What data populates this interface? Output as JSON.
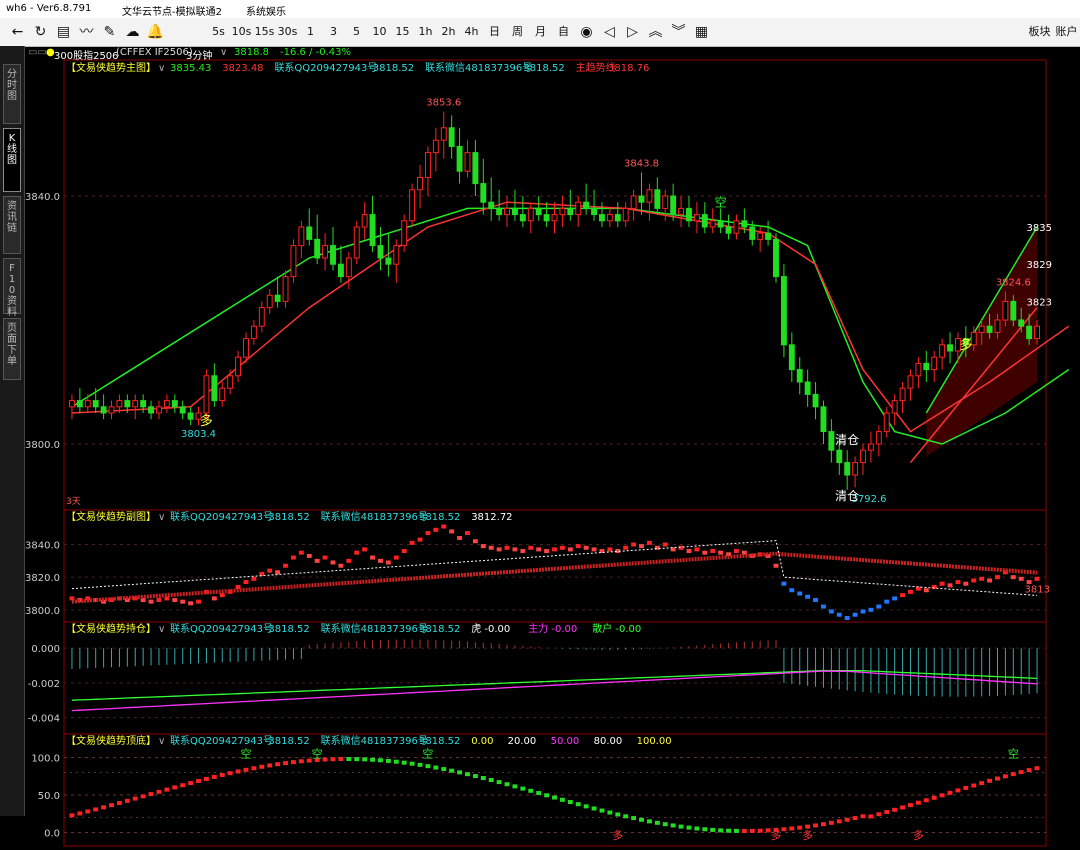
{
  "titlebar": {
    "left": "wh6  -  Ver6.8.791",
    "center": "文华云节点-模拟联通2",
    "right": "系统娱乐"
  },
  "toolbar": {
    "nav_icons": [
      "back-arrow-icon",
      "refresh-icon",
      "report-icon",
      "chart-trend-icon",
      "draw-tool-icon",
      "cloud-sync-icon",
      "bell-icon"
    ],
    "periods": [
      "5s",
      "10s",
      "15s",
      "30s",
      "1",
      "3",
      "5",
      "10",
      "15",
      "1h",
      "2h",
      "4h",
      "日",
      "周",
      "月",
      "自"
    ],
    "tool_icons": [
      "eye-icon",
      "arrow-left-icon",
      "arrow-right-icon",
      "chevron-up-icon",
      "chevron-down-icon",
      "grid-icon"
    ],
    "right_buttons": [
      "板块",
      "账户"
    ]
  },
  "left_tabs": [
    {
      "label": "分时图",
      "active": false
    },
    {
      "label": "K线图",
      "active": true
    },
    {
      "label": "资讯链",
      "active": false
    },
    {
      "label": "F10资料",
      "active": false
    },
    {
      "label": "页面下单",
      "active": false
    }
  ],
  "infobar": {
    "contract": "300股指2506",
    "exchange": "(CFFEX IF2506)",
    "period": "3分钟",
    "price": "3818.8",
    "change": "-16.6 / -0.43%"
  },
  "main_panel": {
    "title": "【文易侠趋势主图】",
    "values": [
      {
        "text": "3835.43",
        "color": "#22ee22"
      },
      {
        "text": "3823.48",
        "color": "#ff3333"
      },
      {
        "text": "联系QQ209427943号",
        "color": "#33dddd"
      },
      {
        "text": "3818.52",
        "color": "#33dddd"
      },
      {
        "text": "联系微信481837396号",
        "color": "#33dddd"
      },
      {
        "text": "3818.52",
        "color": "#33dddd"
      },
      {
        "text": "主趋势线",
        "color": "#ff3333"
      },
      {
        "text": "3818.76",
        "color": "#ff3333"
      }
    ],
    "y_ticks": [
      "3840.0",
      "3800.0"
    ],
    "annotations": {
      "high": "3853.6",
      "high2": "3843.8",
      "low_left": "3803.4",
      "low_mid": "3792.6",
      "high_right": "3824.6",
      "channel_upper": "3835",
      "channel_mid": "3829",
      "channel_lower": "3823",
      "buy_label": "多",
      "sell_label": "空",
      "clear_label": "清仓",
      "period_note": "3天"
    }
  },
  "sub1_panel": {
    "title": "【文易侠趋势副图】",
    "qq": "联系QQ209427943号",
    "qq_val": "3818.52",
    "wx": "联系微信481837396号",
    "wx_val": "3818.52",
    "extra": "3812.72",
    "y_ticks": [
      "3840.0",
      "3820.0",
      "3800.0"
    ],
    "last_label": "3813"
  },
  "sub2_panel": {
    "title": "【文易侠趋势持仓】",
    "qq": "联系QQ209427943号",
    "qq_val": "3818.52",
    "wx": "联系微信481837396号",
    "wx_val": "3818.52",
    "legend": [
      {
        "text": "虎 -0.00",
        "color": "#ffffff"
      },
      {
        "text": "主力 -0.00",
        "color": "#ff33ff"
      },
      {
        "text": "散户 -0.00",
        "color": "#33ff33"
      }
    ],
    "y_ticks": [
      "0.000",
      "-0.002",
      "-0.004"
    ]
  },
  "sub3_panel": {
    "title": "【文易侠趋势顶底】",
    "qq": "联系QQ209427943号",
    "qq_val": "3818.52",
    "wx": "联系微信481837396号",
    "wx_val": "3818.52",
    "levels": [
      {
        "text": "0.00",
        "color": "#ffff33"
      },
      {
        "text": "20.00",
        "color": "#ffffff"
      },
      {
        "text": "50.00",
        "color": "#ff33ff"
      },
      {
        "text": "80.00",
        "color": "#ffffff"
      },
      {
        "text": "100.00",
        "color": "#ffff33"
      }
    ],
    "y_ticks": [
      "100.0",
      "50.0",
      "0.0"
    ]
  },
  "chart_data": {
    "type": "candlestick",
    "note_series": "3-minute IF2506 bars, approximate reading",
    "candles": [
      [
        3806,
        3808,
        3804,
        3807
      ],
      [
        3807,
        3809,
        3805,
        3806
      ],
      [
        3806,
        3808,
        3805,
        3807
      ],
      [
        3807,
        3809,
        3805,
        3806
      ],
      [
        3806,
        3808,
        3804,
        3805
      ],
      [
        3805,
        3807,
        3804,
        3806
      ],
      [
        3806,
        3808,
        3805,
        3807
      ],
      [
        3807,
        3808,
        3805,
        3806
      ],
      [
        3806,
        3808,
        3804,
        3807
      ],
      [
        3807,
        3808,
        3805,
        3806
      ],
      [
        3806,
        3807,
        3804,
        3805
      ],
      [
        3805,
        3807,
        3804,
        3806
      ],
      [
        3806,
        3808,
        3805,
        3807
      ],
      [
        3807,
        3808,
        3805,
        3806
      ],
      [
        3806,
        3807,
        3804,
        3805
      ],
      [
        3805,
        3806,
        3803,
        3804
      ],
      [
        3804,
        3806,
        3803,
        3805
      ],
      [
        3805,
        3812,
        3804,
        3811
      ],
      [
        3811,
        3813,
        3806,
        3807
      ],
      [
        3807,
        3810,
        3806,
        3809
      ],
      [
        3809,
        3812,
        3808,
        3811
      ],
      [
        3811,
        3815,
        3810,
        3814
      ],
      [
        3814,
        3818,
        3813,
        3817
      ],
      [
        3817,
        3820,
        3816,
        3819
      ],
      [
        3819,
        3823,
        3818,
        3822
      ],
      [
        3822,
        3825,
        3821,
        3824
      ],
      [
        3824,
        3827,
        3822,
        3823
      ],
      [
        3823,
        3828,
        3822,
        3827
      ],
      [
        3827,
        3833,
        3826,
        3832
      ],
      [
        3832,
        3836,
        3830,
        3835
      ],
      [
        3835,
        3838,
        3832,
        3833
      ],
      [
        3833,
        3837,
        3829,
        3830
      ],
      [
        3830,
        3834,
        3828,
        3832
      ],
      [
        3832,
        3835,
        3828,
        3829
      ],
      [
        3829,
        3832,
        3826,
        3827
      ],
      [
        3827,
        3831,
        3825,
        3830
      ],
      [
        3830,
        3836,
        3829,
        3835
      ],
      [
        3835,
        3839,
        3833,
        3837
      ],
      [
        3837,
        3840,
        3831,
        3832
      ],
      [
        3832,
        3835,
        3828,
        3830
      ],
      [
        3830,
        3834,
        3827,
        3829
      ],
      [
        3829,
        3833,
        3826,
        3832
      ],
      [
        3832,
        3837,
        3831,
        3836
      ],
      [
        3836,
        3842,
        3835,
        3841
      ],
      [
        3841,
        3845,
        3838,
        3843
      ],
      [
        3843,
        3848,
        3840,
        3847
      ],
      [
        3847,
        3851,
        3844,
        3849
      ],
      [
        3849,
        3853.6,
        3846,
        3851
      ],
      [
        3851,
        3853,
        3846,
        3848
      ],
      [
        3848,
        3851,
        3842,
        3844
      ],
      [
        3844,
        3849,
        3843,
        3847
      ],
      [
        3847,
        3849,
        3840,
        3842
      ],
      [
        3842,
        3846,
        3837,
        3839
      ],
      [
        3839,
        3843,
        3836,
        3838
      ],
      [
        3838,
        3841,
        3836,
        3837
      ],
      [
        3837,
        3840,
        3835,
        3838
      ],
      [
        3838,
        3841,
        3836,
        3837
      ],
      [
        3837,
        3840,
        3835,
        3836
      ],
      [
        3836,
        3839,
        3834,
        3838
      ],
      [
        3838,
        3840,
        3836,
        3837
      ],
      [
        3837,
        3839,
        3835,
        3836
      ],
      [
        3836,
        3839,
        3834,
        3837
      ],
      [
        3837,
        3840,
        3835,
        3838
      ],
      [
        3838,
        3841,
        3836,
        3837
      ],
      [
        3837,
        3840,
        3835,
        3839
      ],
      [
        3839,
        3842,
        3837,
        3838
      ],
      [
        3838,
        3841,
        3836,
        3837
      ],
      [
        3837,
        3839,
        3835,
        3836
      ],
      [
        3836,
        3838,
        3835,
        3837
      ],
      [
        3837,
        3839,
        3835,
        3836
      ],
      [
        3836,
        3839,
        3835,
        3838
      ],
      [
        3838,
        3841,
        3836,
        3840
      ],
      [
        3840,
        3843.8,
        3837,
        3839
      ],
      [
        3839,
        3842,
        3836,
        3841
      ],
      [
        3841,
        3843,
        3837,
        3838
      ],
      [
        3838,
        3841,
        3836,
        3840
      ],
      [
        3840,
        3842,
        3836,
        3837
      ],
      [
        3837,
        3840,
        3835,
        3838
      ],
      [
        3838,
        3840,
        3835,
        3836
      ],
      [
        3836,
        3839,
        3834,
        3837
      ],
      [
        3837,
        3839,
        3834,
        3835
      ],
      [
        3835,
        3838,
        3834,
        3836
      ],
      [
        3836,
        3838,
        3834,
        3835
      ],
      [
        3835,
        3837,
        3833,
        3834
      ],
      [
        3834,
        3837,
        3833,
        3836
      ],
      [
        3836,
        3838,
        3834,
        3835
      ],
      [
        3835,
        3836,
        3832,
        3833
      ],
      [
        3833,
        3835,
        3831,
        3834
      ],
      [
        3834,
        3836,
        3832,
        3833
      ],
      [
        3833,
        3834,
        3826,
        3827
      ],
      [
        3827,
        3829,
        3814,
        3816
      ],
      [
        3816,
        3818,
        3810,
        3812
      ],
      [
        3812,
        3814,
        3808,
        3810
      ],
      [
        3810,
        3812,
        3806,
        3808
      ],
      [
        3808,
        3810,
        3804,
        3806
      ],
      [
        3806,
        3807,
        3800,
        3802
      ],
      [
        3802,
        3804,
        3797,
        3799
      ],
      [
        3799,
        3801,
        3795,
        3797
      ],
      [
        3797,
        3799,
        3792.6,
        3795
      ],
      [
        3795,
        3798,
        3793,
        3797
      ],
      [
        3797,
        3800,
        3795,
        3799
      ],
      [
        3799,
        3802,
        3797,
        3800
      ],
      [
        3800,
        3803,
        3798,
        3802
      ],
      [
        3802,
        3806,
        3801,
        3805
      ],
      [
        3805,
        3808,
        3803,
        3807
      ],
      [
        3807,
        3810,
        3805,
        3809
      ],
      [
        3809,
        3812,
        3807,
        3811
      ],
      [
        3811,
        3814,
        3809,
        3813
      ],
      [
        3813,
        3815,
        3810,
        3812
      ],
      [
        3812,
        3815,
        3810,
        3814
      ],
      [
        3814,
        3817,
        3812,
        3816
      ],
      [
        3816,
        3818,
        3813,
        3815
      ],
      [
        3815,
        3818,
        3813,
        3817
      ],
      [
        3817,
        3819,
        3814,
        3816
      ],
      [
        3816,
        3819,
        3815,
        3818
      ],
      [
        3818,
        3820,
        3816,
        3819
      ],
      [
        3819,
        3821,
        3817,
        3818
      ],
      [
        3818,
        3821,
        3817,
        3820
      ],
      [
        3820,
        3824.6,
        3819,
        3823
      ],
      [
        3823,
        3824,
        3819,
        3820
      ],
      [
        3820,
        3822,
        3818,
        3819
      ],
      [
        3819,
        3821,
        3816,
        3817
      ],
      [
        3817,
        3820,
        3816,
        3819
      ]
    ],
    "trend_line_green_points": [
      [
        0,
        3806
      ],
      [
        30,
        3830
      ],
      [
        50,
        3838
      ],
      [
        70,
        3838
      ],
      [
        88,
        3835
      ],
      [
        93,
        3832
      ],
      [
        100,
        3810
      ],
      [
        104,
        3802
      ],
      [
        110,
        3800
      ],
      [
        118,
        3805
      ],
      [
        126,
        3812
      ]
    ],
    "trend_line_red_points": [
      [
        0,
        3805
      ],
      [
        15,
        3806
      ],
      [
        30,
        3822
      ],
      [
        45,
        3835
      ],
      [
        55,
        3839
      ],
      [
        70,
        3838
      ],
      [
        88,
        3834
      ],
      [
        94,
        3829
      ],
      [
        100,
        3812
      ],
      [
        106,
        3802
      ],
      [
        116,
        3810
      ],
      [
        126,
        3819
      ]
    ],
    "y_range": [
      3790,
      3860
    ]
  }
}
